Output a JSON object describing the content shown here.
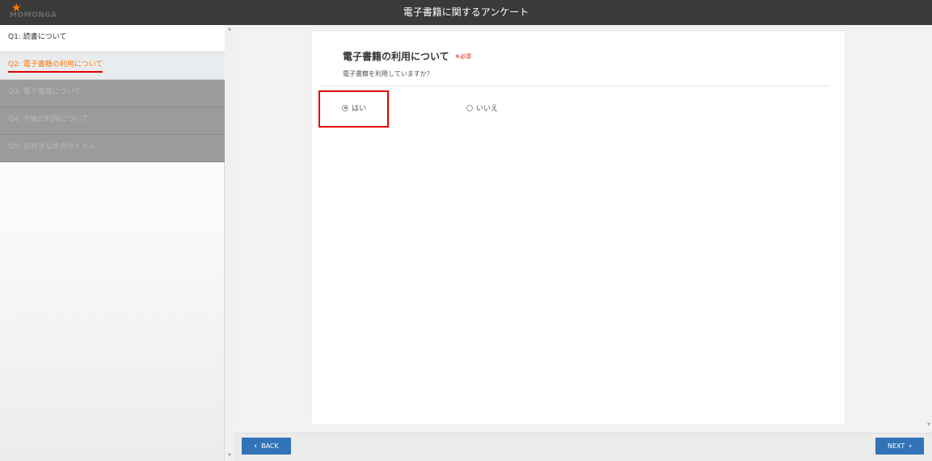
{
  "logo": {
    "text": "MOMONGA",
    "icon": "star-icon"
  },
  "app_title": "電子書籍に関するアンケート",
  "sidebar": {
    "items": [
      {
        "label": "Q1: 読書について",
        "state": "done"
      },
      {
        "label": "Q2: 電子書籍の利用について",
        "state": "current"
      },
      {
        "label": "Q3: 電子書籍について",
        "state": "locked"
      },
      {
        "label": "Q4: 今後の利用について",
        "state": "locked"
      },
      {
        "label": "Q5: お好きな本のタイトル",
        "state": "locked"
      }
    ]
  },
  "question": {
    "title": "電子書籍の利用について",
    "required": "※必須",
    "subtitle": "電子書籍を利用していますか？",
    "options": [
      {
        "label": "はい",
        "selected": true
      },
      {
        "label": "いいえ",
        "selected": false
      }
    ]
  },
  "footer": {
    "back_label": "BACK",
    "next_label": "NEXT",
    "back_icon": "chevron-left-icon",
    "next_icon": "chevron-right-icon"
  },
  "colors": {
    "topbar": "#3a3a3a",
    "accent_orange": "#ff7a00",
    "highlight_red": "#e50000",
    "button_blue": "#3273b8",
    "locked_gray": "#9b9b9b"
  }
}
